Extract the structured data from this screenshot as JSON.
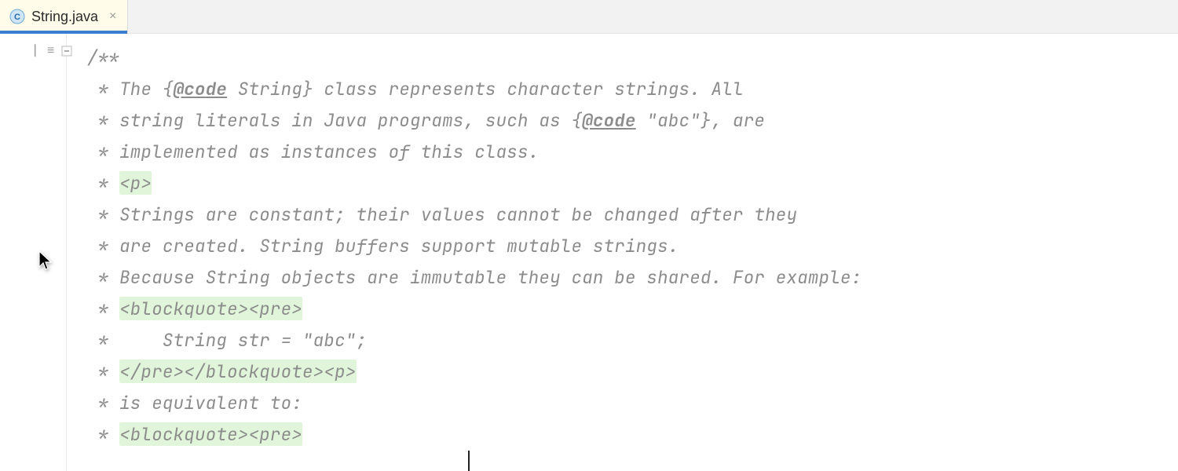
{
  "tab": {
    "filename": "String.java",
    "close_glyph": "×"
  },
  "icons": {
    "structure_glyph": "⎸≡"
  },
  "code": {
    "l0": "/**",
    "l1a": " * The {",
    "l1b": "@code",
    "l1c": " String} class represents character strings. All",
    "l2a": " * string literals in Java programs, such as {",
    "l2b": "@code",
    "l2c": " \"abc\"}, are",
    "l3": " * implemented as instances of this class.",
    "l4a": " * ",
    "l4b": "<p>",
    "l5": " * Strings are constant; their values cannot be changed after they",
    "l6": " * are created. String buffers support mutable strings.",
    "l7": " * Because String objects are immutable they can be shared. For example:",
    "l8a": " * ",
    "l8b": "<blockquote><pre>",
    "l9": " *     String str = \"abc\";",
    "l10a": " * ",
    "l10b": "</pre></blockquote><p>",
    "l11": " * is equivalent to:",
    "l12a": " * ",
    "l12b": "<blockquote><pre>"
  }
}
